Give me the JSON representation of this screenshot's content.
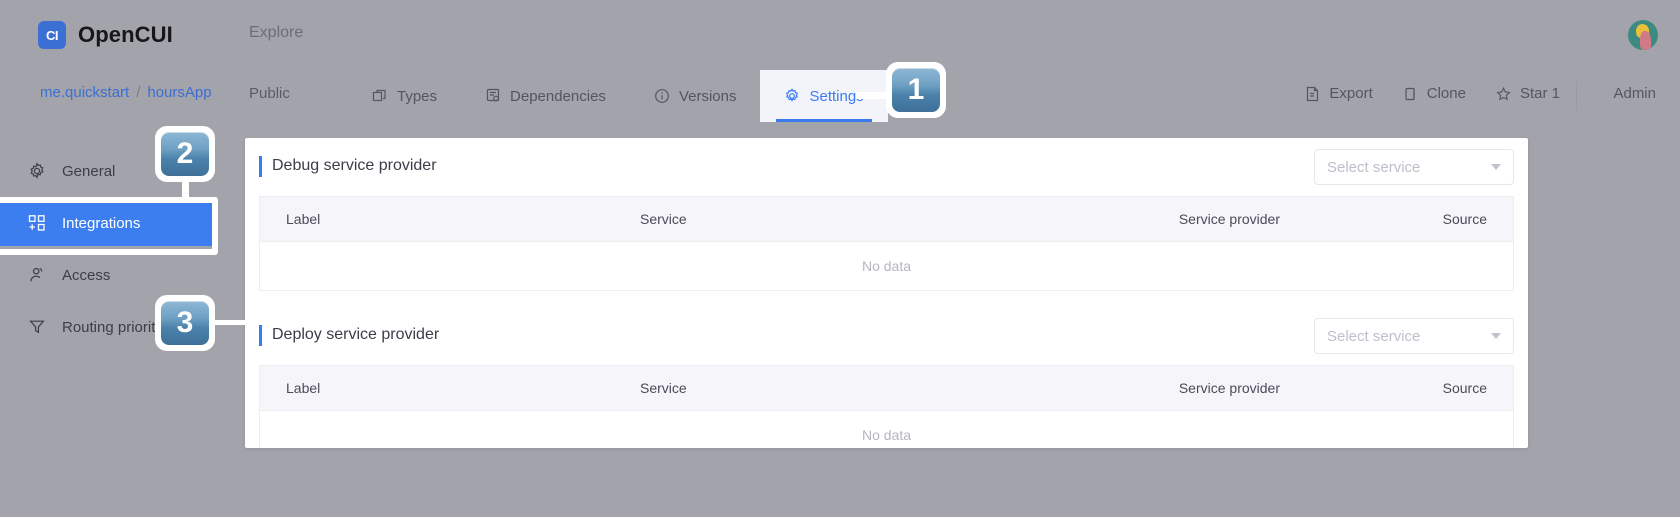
{
  "app": {
    "logo_mark": "CI",
    "logo_text": "OpenCUI",
    "explore_label": "Explore",
    "avatar_name": "user-avatar"
  },
  "breadcrumb": {
    "org": "me.quickstart",
    "separator": "/",
    "project": "hoursApp",
    "visibility": "Public"
  },
  "tabs": [
    {
      "label": "Types",
      "icon": "types-icon",
      "active": false
    },
    {
      "label": "Dependencies",
      "icon": "dependencies-icon",
      "active": false
    },
    {
      "label": "Versions",
      "icon": "versions-icon",
      "active": false
    },
    {
      "label": "Settings",
      "icon": "gear-icon",
      "active": true
    }
  ],
  "right_actions": [
    {
      "label": "Export",
      "icon": "export-icon"
    },
    {
      "label": "Clone",
      "icon": "clone-icon"
    },
    {
      "label": "Star 1",
      "icon": "star-icon"
    }
  ],
  "admin_label": "Admin",
  "sidebar": {
    "items": [
      {
        "label": "General",
        "icon": "gear-icon",
        "active": false
      },
      {
        "label": "Integrations",
        "icon": "integrations-icon",
        "active": true
      },
      {
        "label": "Access",
        "icon": "access-icon",
        "active": false
      },
      {
        "label": "Routing priority",
        "icon": "routing-icon",
        "active": false
      }
    ]
  },
  "sections": [
    {
      "title": "Debug service provider",
      "select_placeholder": "Select service",
      "columns": [
        "Label",
        "Service",
        "Service provider",
        "Source"
      ],
      "empty_text": "No data"
    },
    {
      "title": "Deploy service provider",
      "select_placeholder": "Select service",
      "columns": [
        "Label",
        "Service",
        "Service provider",
        "Source"
      ],
      "empty_text": "No data"
    }
  ],
  "callouts": [
    {
      "number": "1"
    },
    {
      "number": "2"
    },
    {
      "number": "3"
    }
  ],
  "colors": {
    "accent_blue": "#3b7bf0",
    "sidebar_active": "#3c7ef0",
    "badge_blue": "#5c93ba",
    "dim_overlay": "#a3a3ab"
  }
}
